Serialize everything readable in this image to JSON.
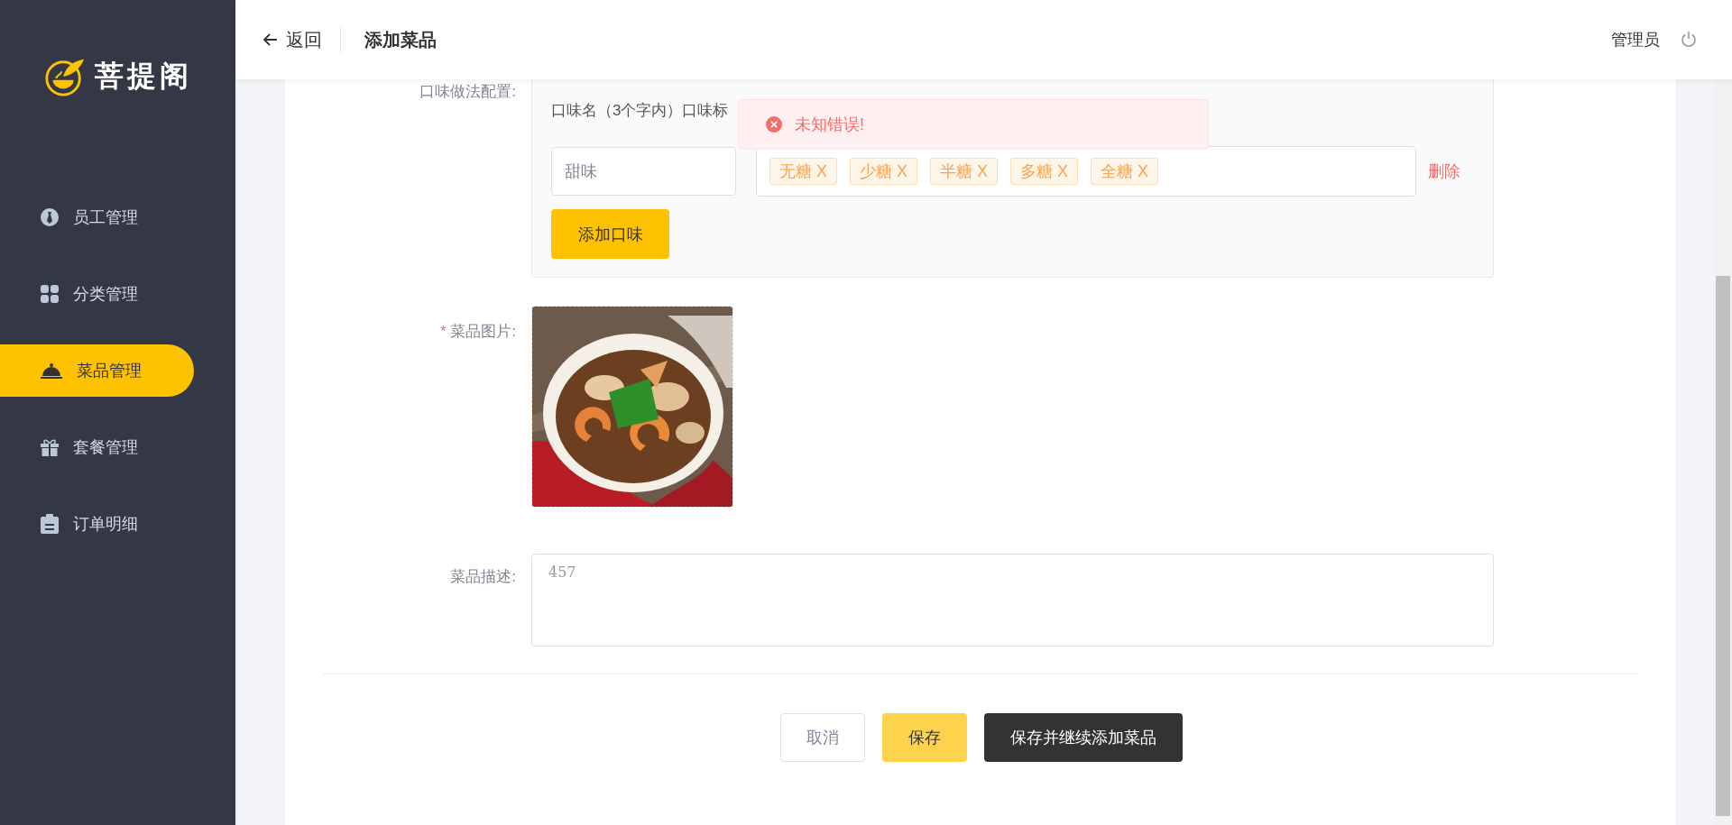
{
  "sidebar": {
    "logo": "菩提阁",
    "items": [
      {
        "label": "员工管理",
        "selected": false
      },
      {
        "label": "分类管理",
        "selected": false
      },
      {
        "label": "菜品管理",
        "selected": true
      },
      {
        "label": "套餐管理",
        "selected": false
      },
      {
        "label": "订单明细",
        "selected": false
      }
    ]
  },
  "header": {
    "back": "返回",
    "title": "添加菜品",
    "user": "管理员"
  },
  "form": {
    "flavor": {
      "label": "口味做法配置:",
      "hint": "口味名（3个字内）口味标",
      "rows": [
        {
          "name": "甜味",
          "tags": [
            "无糖 X",
            "少糖 X",
            "半糖 X",
            "多糖 X",
            "全糖 X"
          ],
          "delete": "删除"
        }
      ],
      "add_button": "添加口味"
    },
    "image": {
      "label": "菜品图片:",
      "required_mark": "*"
    },
    "description": {
      "label": "菜品描述:",
      "value": "457"
    }
  },
  "buttons": [
    {
      "label": "取消",
      "kind": "cancel"
    },
    {
      "label": "保存",
      "kind": "save"
    },
    {
      "label": "保存并继续添加菜品",
      "kind": "dark"
    }
  ],
  "toast": {
    "message": "未知错误!",
    "kind": "error"
  }
}
